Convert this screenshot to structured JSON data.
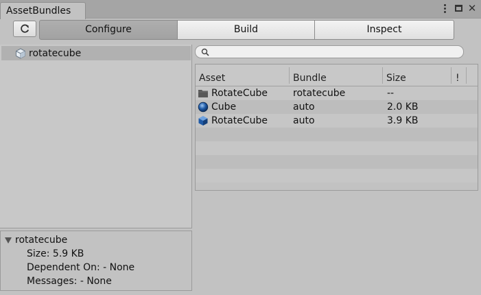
{
  "window": {
    "tab_title": "AssetBundles"
  },
  "toolbar": {
    "refresh_icon": "refresh-icon",
    "tabs": [
      {
        "label": "Configure",
        "active": true
      },
      {
        "label": "Build",
        "active": false
      },
      {
        "label": "Inspect",
        "active": false
      }
    ]
  },
  "tree": {
    "items": [
      {
        "label": "rotatecube",
        "icon": "cube-outline-icon",
        "selected": true
      }
    ]
  },
  "details": {
    "title": "rotatecube",
    "size": "Size: 5.9 KB",
    "dependent_on": "Dependent On: - None",
    "messages": "Messages: - None"
  },
  "search": {
    "value": "",
    "placeholder": ""
  },
  "table": {
    "columns": [
      "Asset",
      "Bundle",
      "Size",
      "!"
    ],
    "rows": [
      {
        "asset": "RotateCube",
        "bundle": "rotatecube",
        "size": "--",
        "icon": "folder-icon"
      },
      {
        "asset": "Cube",
        "bundle": "auto",
        "size": "2.0 KB",
        "icon": "sphere-icon"
      },
      {
        "asset": "RotateCube",
        "bundle": "auto",
        "size": "3.9 KB",
        "icon": "cube-icon"
      }
    ]
  },
  "colors": {
    "background": "#c2c2c2",
    "active_tab": "#a8a8a8",
    "selection": "#b1b1b1",
    "sphere_blue": "#1f5aa6"
  }
}
